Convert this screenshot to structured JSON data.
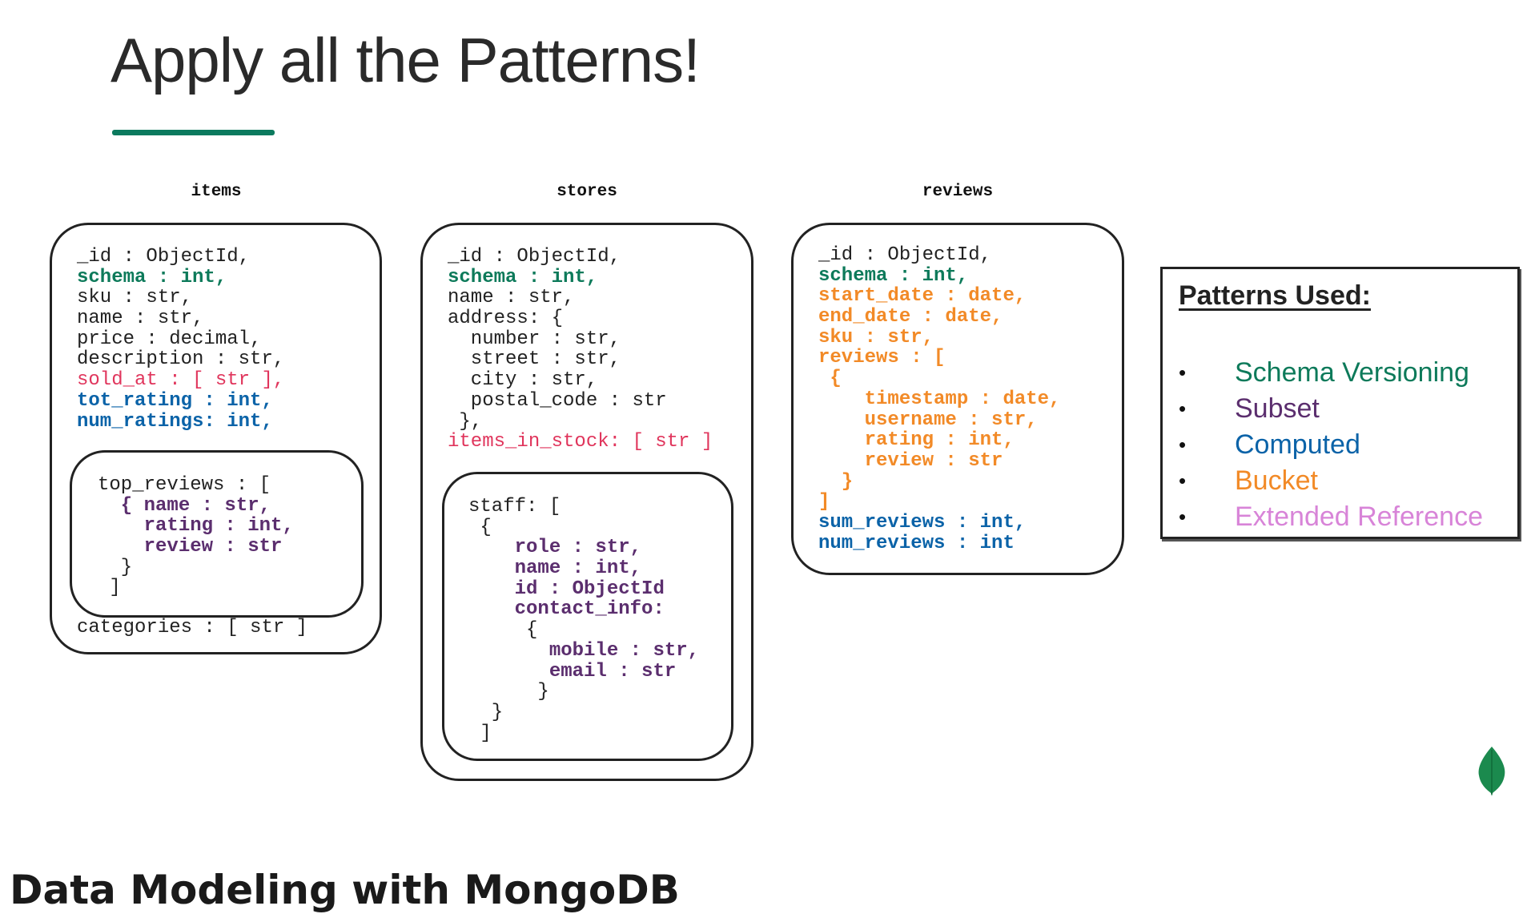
{
  "title": "Apply all the Patterns!",
  "colors": {
    "accent_rule": "#0c7a5e",
    "schema_versioning": "#0d7a5a",
    "subset": "#5b2e6e",
    "computed": "#0b63a8",
    "bucket": "#f28a27",
    "extended_reference": "#d884d8"
  },
  "collections": {
    "items": {
      "heading": "items",
      "lines_top": [
        {
          "text": "_id : ObjectId,",
          "color": "black"
        },
        {
          "text": "schema : int,",
          "color": "green"
        },
        {
          "text": "sku : str,",
          "color": "black"
        },
        {
          "text": "name : str,",
          "color": "black"
        },
        {
          "text": "price : decimal,",
          "color": "black"
        },
        {
          "text": "description : str,",
          "color": "black"
        },
        {
          "text": "sold_at : [ str ],",
          "color": "red"
        },
        {
          "text": "tot_rating : int,",
          "color": "blue"
        },
        {
          "text": "num_ratings: int,",
          "color": "blue"
        }
      ],
      "inner_lines": [
        {
          "text": "top_reviews : [",
          "color": "black"
        },
        {
          "text": "  { name : str,",
          "color": "purple"
        },
        {
          "text": "    rating : int,",
          "color": "purple"
        },
        {
          "text": "    review : str",
          "color": "purple"
        },
        {
          "text": "  }",
          "color": "black"
        },
        {
          "text": " ]",
          "color": "black"
        }
      ],
      "lines_bottom": [
        {
          "text": "categories : [ str ]",
          "color": "black"
        }
      ]
    },
    "stores": {
      "heading": "stores",
      "lines_top": [
        {
          "text": "_id : ObjectId,",
          "color": "black"
        },
        {
          "text": "schema : int,",
          "color": "green"
        },
        {
          "text": "name : str,",
          "color": "black"
        },
        {
          "text": "address: {",
          "color": "black"
        },
        {
          "text": "  number : str,",
          "color": "black"
        },
        {
          "text": "  street : str,",
          "color": "black"
        },
        {
          "text": "  city : str,",
          "color": "black"
        },
        {
          "text": "  postal_code : str",
          "color": "black"
        },
        {
          "text": " },",
          "color": "black"
        },
        {
          "text": "items_in_stock: [ str ]",
          "color": "red"
        }
      ],
      "inner_lines": [
        {
          "text": "staff: [",
          "color": "black"
        },
        {
          "text": " {",
          "color": "black"
        },
        {
          "text": "    role : str,",
          "color": "purple"
        },
        {
          "text": "    name : int,",
          "color": "purple"
        },
        {
          "text": "    id : ObjectId",
          "color": "purple"
        },
        {
          "text": "    contact_info:",
          "color": "purple"
        },
        {
          "text": "     {",
          "color": "black"
        },
        {
          "text": "       mobile : str,",
          "color": "purple"
        },
        {
          "text": "       email : str",
          "color": "purple"
        },
        {
          "text": "      }",
          "color": "black"
        },
        {
          "text": "  }",
          "color": "black"
        },
        {
          "text": " ]",
          "color": "black"
        }
      ]
    },
    "reviews": {
      "heading": "reviews",
      "lines_top": [
        {
          "text": "_id : ObjectId,",
          "color": "black"
        },
        {
          "text": "schema : int,",
          "color": "green"
        },
        {
          "text": "start_date : date,",
          "color": "orange"
        },
        {
          "text": "end_date : date,",
          "color": "orange"
        },
        {
          "text": "sku : str,",
          "color": "orange"
        },
        {
          "text": "reviews : [",
          "color": "orange"
        },
        {
          "text": " {",
          "color": "orange"
        },
        {
          "text": "    timestamp : date,",
          "color": "orange"
        },
        {
          "text": "    username : str,",
          "color": "orange"
        },
        {
          "text": "    rating : int,",
          "color": "orange"
        },
        {
          "text": "    review : str",
          "color": "orange"
        },
        {
          "text": "  }",
          "color": "orange"
        },
        {
          "text": "]",
          "color": "orange"
        },
        {
          "text": "sum_reviews : int,",
          "color": "blue"
        },
        {
          "text": "num_reviews : int",
          "color": "blue"
        }
      ]
    }
  },
  "legend": {
    "title": "Patterns Used:",
    "items": [
      {
        "label": "Schema Versioning",
        "color": "#0d7a5a"
      },
      {
        "label": "Subset",
        "color": "#5b2e6e"
      },
      {
        "label": "Computed",
        "color": "#0b63a8"
      },
      {
        "label": "Bucket",
        "color": "#f28a27"
      },
      {
        "label": "Extended Reference",
        "color": "#d884d8"
      }
    ]
  },
  "footer": "Data Modeling with MongoDB",
  "icons": {
    "logo": "mongodb-leaf-icon"
  }
}
